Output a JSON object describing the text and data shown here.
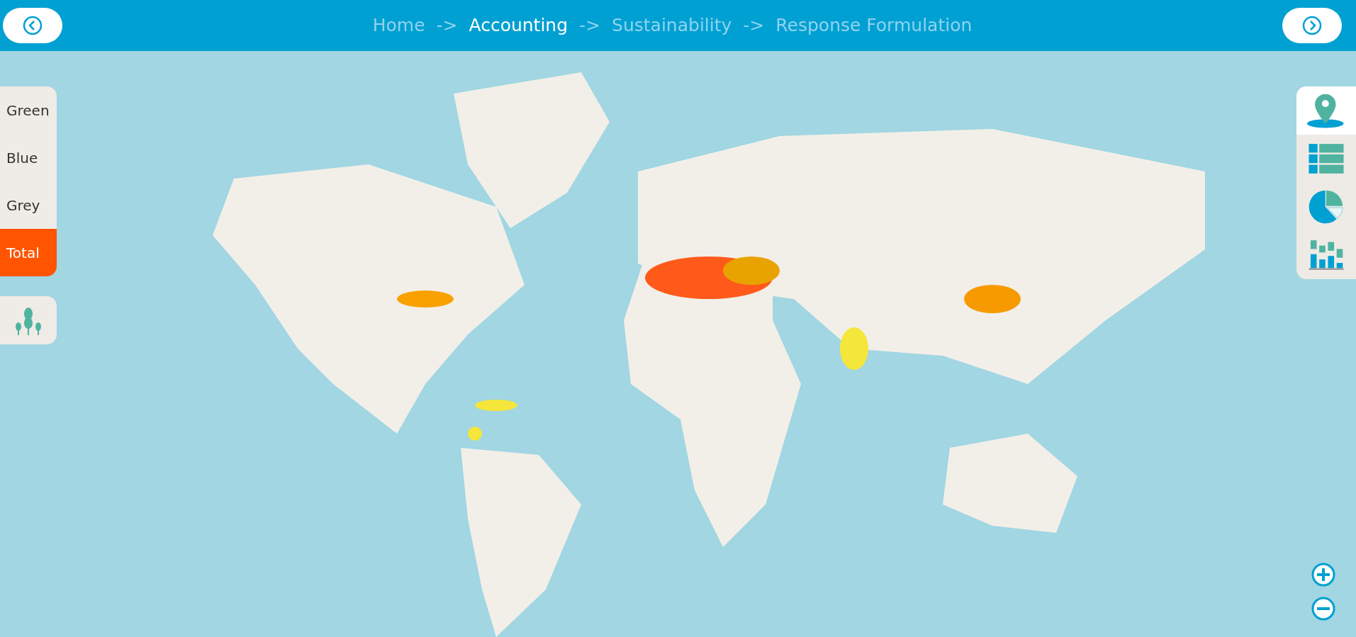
{
  "breadcrumb": {
    "separator": "->",
    "items": [
      {
        "label": "Home",
        "selected": false
      },
      {
        "label": "Accounting",
        "selected": true
      },
      {
        "label": "Sustainability",
        "selected": false
      },
      {
        "label": "Response Formulation",
        "selected": false
      }
    ]
  },
  "layers": [
    {
      "label": "Green",
      "selected": false
    },
    {
      "label": "Blue",
      "selected": false
    },
    {
      "label": "Grey",
      "selected": false
    },
    {
      "label": "Total",
      "selected": true
    }
  ],
  "views": [
    {
      "kind": "map",
      "selected": true
    },
    {
      "kind": "table",
      "selected": false
    },
    {
      "kind": "pie",
      "selected": false
    },
    {
      "kind": "bars",
      "selected": false
    }
  ]
}
